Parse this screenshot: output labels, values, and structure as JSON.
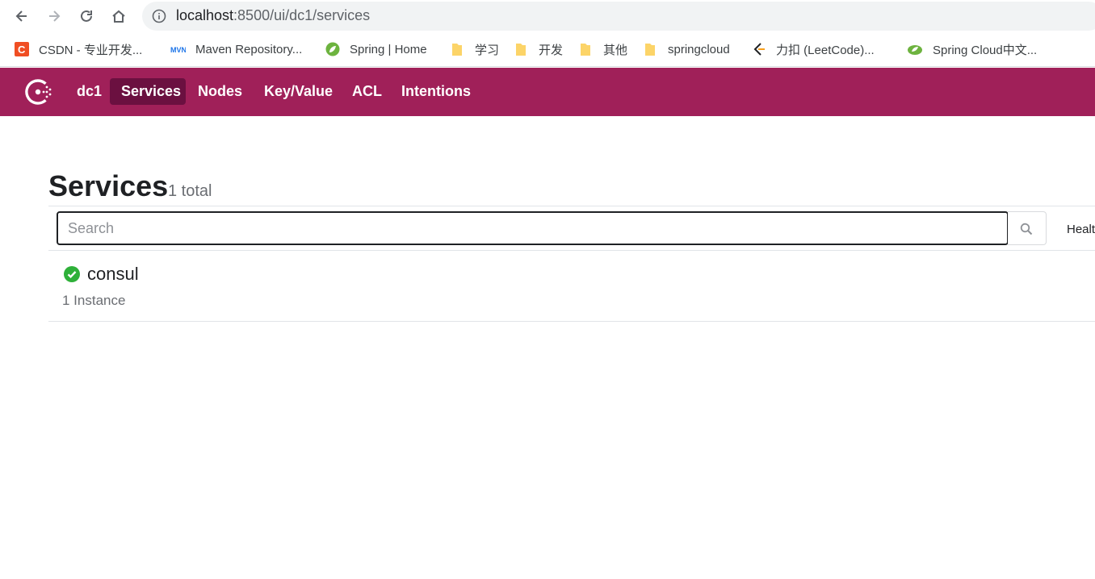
{
  "browser": {
    "url_host": "localhost",
    "url_path": ":8500/ui/dc1/services",
    "icons": {
      "back": "back-arrow-icon",
      "forward": "forward-arrow-icon",
      "reload": "reload-icon",
      "home": "home-icon",
      "info": "info-icon"
    }
  },
  "bookmarks": [
    {
      "label": "CSDN - 专业开发...",
      "icon": "csdn-icon",
      "color": "#f04e23"
    },
    {
      "label": "Maven Repository...",
      "icon": "mvn-icon",
      "color": "#1a73e8"
    },
    {
      "label": "Spring | Home",
      "icon": "spring-leaf-icon",
      "color": "#6db33f"
    },
    {
      "label": "学习",
      "icon": "folder-icon",
      "color": "#fcd468"
    },
    {
      "label": "开发",
      "icon": "folder-icon",
      "color": "#fcd468"
    },
    {
      "label": "其他",
      "icon": "folder-icon",
      "color": "#fcd468"
    },
    {
      "label": "springcloud",
      "icon": "folder-icon",
      "color": "#fcd468"
    },
    {
      "label": "力扣 (LeetCode)...",
      "icon": "leetcode-icon",
      "color": "#f89f1b"
    },
    {
      "label": "Spring Cloud中文...",
      "icon": "spring-cloud-icon",
      "color": "#6db33f"
    }
  ],
  "consul_nav": {
    "datacenter": "dc1",
    "items": [
      "Services",
      "Nodes",
      "Key/Value",
      "ACL",
      "Intentions"
    ],
    "active": "Services",
    "brand_color": "#a02059"
  },
  "page": {
    "title": "Services",
    "total": "1 total",
    "search_placeholder": "Search",
    "health_label": "Healt"
  },
  "services": [
    {
      "name": "consul",
      "instances": "1 Instance",
      "status": "passing",
      "status_color": "#2eb039"
    }
  ]
}
